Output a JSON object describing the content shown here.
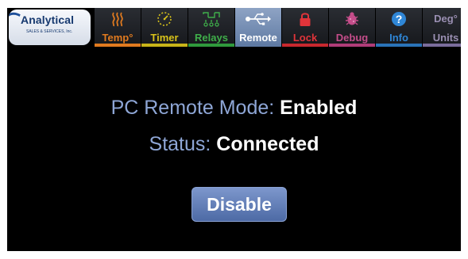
{
  "brand": {
    "name": "Analytical",
    "tagline": "SALES & SERVICES, Inc."
  },
  "tabs": [
    {
      "label": "Temp°",
      "icon": "heat-waves-icon",
      "color": "#e07a1f",
      "underline": "#e07a1f",
      "active": false
    },
    {
      "label": "Timer",
      "icon": "timer-dial-icon",
      "color": "#d8c21a",
      "underline": "#c8b418",
      "active": false
    },
    {
      "label": "Relays",
      "icon": "relays-icon",
      "color": "#3fae4a",
      "underline": "#2f9a3c",
      "active": false
    },
    {
      "label": "Remote",
      "icon": "usb-icon",
      "color": "#ffffff",
      "underline": "#5f7aa3",
      "active": true
    },
    {
      "label": "Lock",
      "icon": "lock-icon",
      "color": "#e0343a",
      "underline": "#c8282e",
      "active": false
    },
    {
      "label": "Debug",
      "icon": "bug-icon",
      "color": "#c44d8a",
      "underline": "#b03c78",
      "active": false
    },
    {
      "label": "Info",
      "icon": "info-icon",
      "color": "#2f86d6",
      "underline": "#2a73b8",
      "active": false
    },
    {
      "label": "Deg°",
      "sublabel": "Units",
      "icon": "units-icon",
      "color": "#9a8fb2",
      "underline": "#7a6c9c",
      "active": false
    }
  ],
  "main": {
    "mode_label": "PC Remote Mode:",
    "mode_value": "Enabled",
    "status_label": "Status:",
    "status_value": "Connected",
    "button_label": "Disable"
  }
}
